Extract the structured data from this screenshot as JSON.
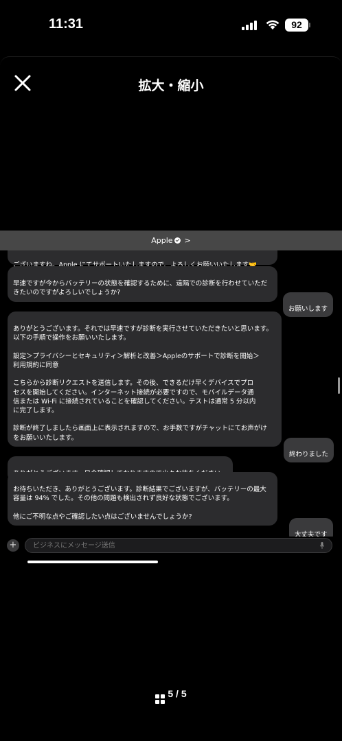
{
  "status_bar": {
    "time": "11:31",
    "battery": "92"
  },
  "viewer": {
    "title": "拡大・縮小",
    "page_indicator": "5 / 5"
  },
  "chat": {
    "business_name": "Apple",
    "messages": [
      {
        "from": "business",
        "text": "ありがとうございます。それでは早速ですが診断を実行させていただきたいと思います。以下の手順で操作をお願いいたします。\n\n設定＞プライバシーとセキュリティ＞解析と改善＞Appleのサポートで診断を開始＞\n利用規約に同意\n\nこちらから診断リクエストを送信します。その後、できるだけ早くデバイスでプロ\nセスを開始してください。インターネット接続が必要ですので、モバイルデータ通\n信または Wi-Fi に接続されていることを確認してください。テストは通常 5 分以内\nに完了します。\n\n診断が終了しましたら画面上に表示されますので、お手数ですがチャットにてお声がけ\nをお願いいたします。"
      }
    ],
    "partial_first": "ございますね。Apple にてサポートいたしますので、よろしくお願いいたします🤝",
    "bubble_2": "早速ですが今からバッテリーの状態を確認するために、遠隔での診断を行わせていただ\nきたいのですがよろしいでしょうか?",
    "reply_1": "お願いします",
    "reply_2": "終わりました",
    "bubble_4": "ありがとうございます。只今確認しておりますので少々お待ちください。",
    "bubble_5": "お待ちいただき、ありがとうございます。診断結果でございますが、バッテリーの最大\n容量は 94% でした。その他の問題も検出されず良好な状態でございます。\n\n他にご不明な点やご確認したい点はございませんでしょうか?",
    "reply_3": "大丈夫です",
    "composer_placeholder": "ビジネスにメッセージ送信"
  }
}
